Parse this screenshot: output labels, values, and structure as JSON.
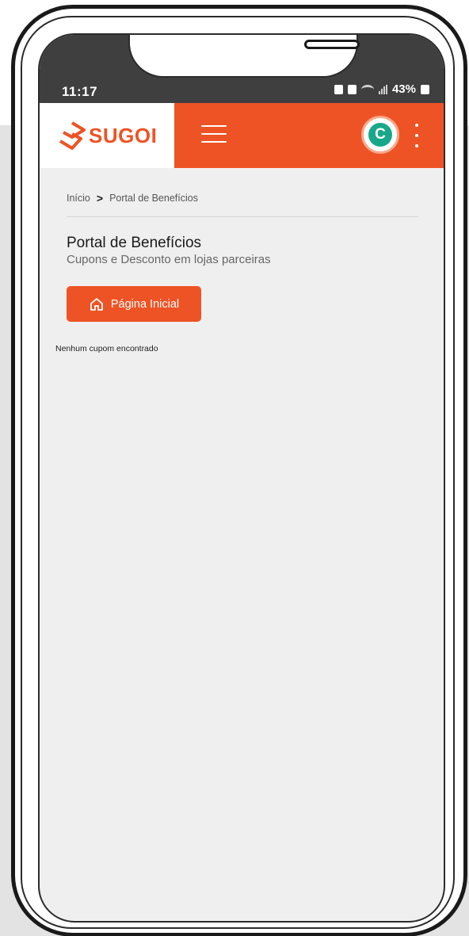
{
  "status_bar": {
    "time": "11:17",
    "battery": "43%"
  },
  "header": {
    "brand": "SUGOI",
    "avatar_letter": "C"
  },
  "breadcrumb": {
    "home": "Início",
    "separator": ">",
    "current": "Portal de Benefícios"
  },
  "page": {
    "title": "Portal de Benefícios",
    "subtitle": "Cupons e Desconto em lojas parceiras",
    "home_button_label": "Página Inicial",
    "empty_message": "Nenhum cupom encontrado"
  },
  "colors": {
    "accent": "#ee5325",
    "avatar_green": "#18a889",
    "screen_bg": "#efefef",
    "status_bar_bg": "#3f3f3f"
  },
  "icons": [
    "home-icon",
    "hamburger-menu-icon",
    "kebab-menu-icon",
    "wifi-icon",
    "signal-icon",
    "battery-icon",
    "alarm-icon"
  ]
}
